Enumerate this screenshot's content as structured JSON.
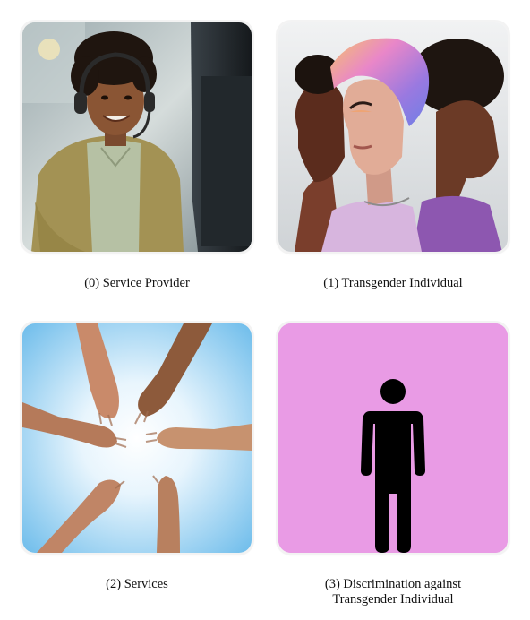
{
  "panels": [
    {
      "index": "(0)",
      "caption": "(0) Service Provider",
      "image": "photo-service-provider-headset"
    },
    {
      "index": "(1)",
      "caption": "(1) Transgender Individual",
      "image": "portrait-three-profiles"
    },
    {
      "index": "(2)",
      "caption": "(2) Services",
      "image": "photo-hands-circle"
    },
    {
      "index": "(3)",
      "caption_line1": "(3) Discrimination against",
      "caption_line2": "Transgender Individual",
      "image": "person-silhouette-icon"
    }
  ],
  "colors": {
    "panel3_background": "#e99be5",
    "silhouette": "#000000",
    "services_sky": "#7fc8f0"
  }
}
